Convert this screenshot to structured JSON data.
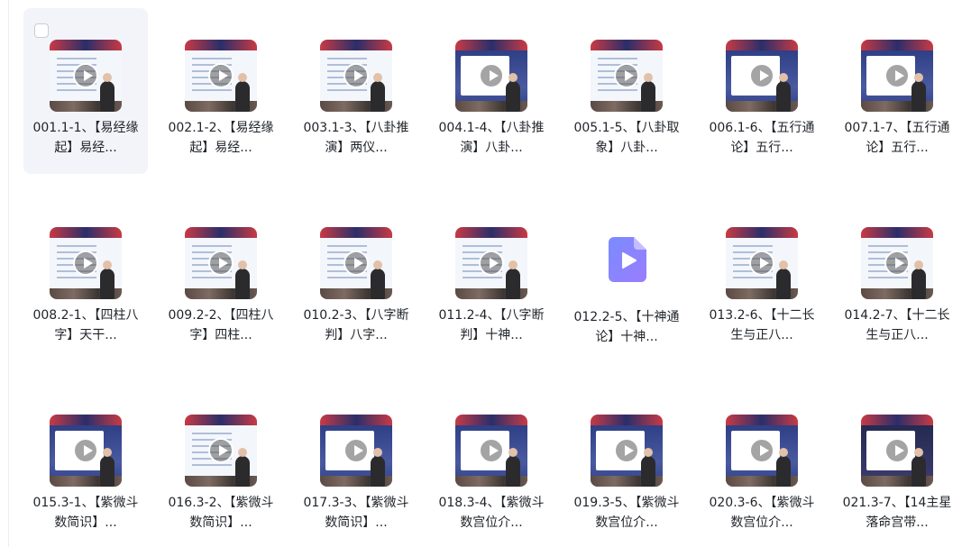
{
  "files": [
    {
      "title": "001.1-1、【易经缘起】易经...",
      "kind": "video",
      "screen": "light",
      "selected": true
    },
    {
      "title": "002.1-2、【易经缘起】易经...",
      "kind": "video",
      "screen": "light",
      "selected": false
    },
    {
      "title": "003.1-3、【八卦推演】两仪...",
      "kind": "video",
      "screen": "light",
      "selected": false
    },
    {
      "title": "004.1-4、【八卦推演】八卦...",
      "kind": "video",
      "screen": "blue",
      "selected": false
    },
    {
      "title": "005.1-5、【八卦取象】八卦...",
      "kind": "video",
      "screen": "light",
      "selected": false
    },
    {
      "title": "006.1-6、【五行通论】五行...",
      "kind": "video",
      "screen": "blue",
      "selected": false
    },
    {
      "title": "007.1-7、【五行通论】五行...",
      "kind": "video",
      "screen": "blue",
      "selected": false
    },
    {
      "title": "008.2-1、【四柱八字】天干...",
      "kind": "video",
      "screen": "light",
      "selected": false
    },
    {
      "title": "009.2-2、【四柱八字】四柱...",
      "kind": "video",
      "screen": "light",
      "selected": false
    },
    {
      "title": "010.2-3、【八字断判】八字...",
      "kind": "video",
      "screen": "light",
      "selected": false
    },
    {
      "title": "011.2-4、【八字断判】十神...",
      "kind": "video",
      "screen": "light",
      "selected": false
    },
    {
      "title": "012.2-5、【十神通论】十神...",
      "kind": "file",
      "screen": "none",
      "selected": false
    },
    {
      "title": "013.2-6、【十二长生与正八...",
      "kind": "video",
      "screen": "light",
      "selected": false
    },
    {
      "title": "014.2-7、【十二长生与正八...",
      "kind": "video",
      "screen": "light",
      "selected": false
    },
    {
      "title": "015.3-1、【紫微斗数简识】...",
      "kind": "video",
      "screen": "blue",
      "selected": false
    },
    {
      "title": "016.3-2、【紫微斗数简识】...",
      "kind": "video",
      "screen": "light",
      "selected": false
    },
    {
      "title": "017.3-3、【紫微斗数简识】...",
      "kind": "video",
      "screen": "blue",
      "selected": false
    },
    {
      "title": "018.3-4、【紫微斗数宫位介...",
      "kind": "video",
      "screen": "blue",
      "selected": false
    },
    {
      "title": "019.3-5、【紫微斗数宫位介...",
      "kind": "video",
      "screen": "blue",
      "selected": false
    },
    {
      "title": "020.3-6、【紫微斗数宫位介...",
      "kind": "video",
      "screen": "blue",
      "selected": false
    },
    {
      "title": "021.3-7、【14主星落命宫带...",
      "kind": "video",
      "screen": "dark",
      "selected": false
    }
  ],
  "icons": {
    "video_overlay": "play-circle-icon",
    "file": "video-file-icon"
  },
  "colors": {
    "selected_tile_bg": "#f2f4fa",
    "file_icon_gradient_start": "#7a8bff",
    "file_icon_gradient_end": "#9a7dff",
    "caption_text": "#1f2329"
  }
}
